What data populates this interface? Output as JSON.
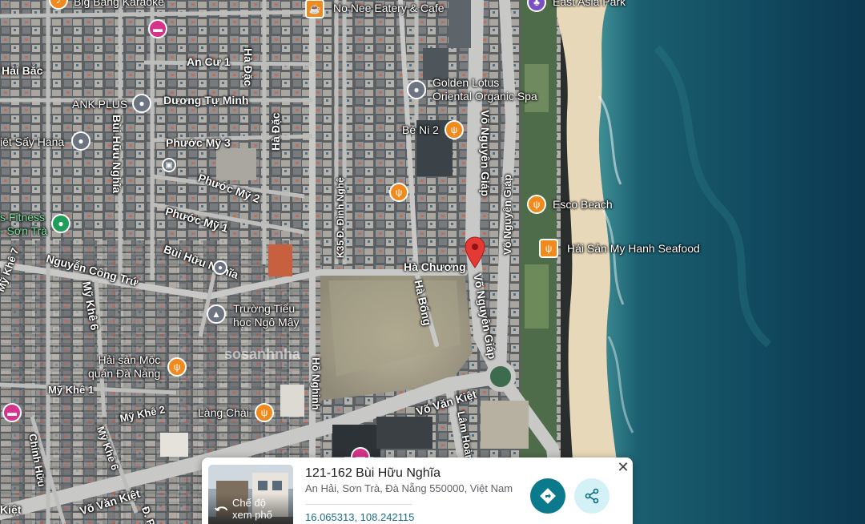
{
  "map": {
    "streets": [
      {
        "id": "hai-bac",
        "text": "Hải Bắc"
      },
      {
        "id": "an-cu-1",
        "text": "An Cư 1"
      },
      {
        "id": "duong-tu-minh",
        "text": "Dương Tự Minh"
      },
      {
        "id": "ha-dac-top",
        "text": "Hà Đặc"
      },
      {
        "id": "ha-dac-mid",
        "text": "Hà Đặc"
      },
      {
        "id": "phuoc-my-3",
        "text": "Phước Mỹ 3"
      },
      {
        "id": "phuoc-my-2",
        "text": "Phước Mỹ 2"
      },
      {
        "id": "phuoc-my-1",
        "text": "Phước Mỹ 1"
      },
      {
        "id": "bui-huu-nghia-v",
        "text": "Bùi Hữu Nghĩa"
      },
      {
        "id": "bui-huu-nghia-d",
        "text": "Bùi Hữu Nghĩa"
      },
      {
        "id": "nguyen-cong-tru",
        "text": "Nguyễn Công Trứ"
      },
      {
        "id": "my-khe-7",
        "text": "Mỹ Khê 7"
      },
      {
        "id": "my-khe-6a",
        "text": "Mỹ Khê 6"
      },
      {
        "id": "my-khe-1",
        "text": "Mỹ Khê 1"
      },
      {
        "id": "my-khe-2",
        "text": "Mỹ Khê 2"
      },
      {
        "id": "my-khe-6b",
        "text": "Mỹ Khê 6"
      },
      {
        "id": "chinh-huu",
        "text": "Chính Hữu"
      },
      {
        "id": "k35-dinh-nghe",
        "text": "K35 Đ. Đình Nghệ"
      },
      {
        "id": "ha-chuong",
        "text": "Hà Chương"
      },
      {
        "id": "ha-bong",
        "text": "Hà Bổng"
      },
      {
        "id": "ho-nghinh",
        "text": "Hồ Nghinh"
      },
      {
        "id": "vo-nguyen-giap-1",
        "text": "Võ Nguyên Giáp"
      },
      {
        "id": "vo-nguyen-giap-2",
        "text": "Võ Nguyên Giáp"
      },
      {
        "id": "vo-nguyen-giap-3",
        "text": "Võ Nguyên Giáp"
      },
      {
        "id": "vo-van-kiet-1",
        "text": "Võ Văn Kiệt"
      },
      {
        "id": "vo-van-kiet-2",
        "text": "Võ Văn Kiệt"
      },
      {
        "id": "lam-hoanh",
        "text": "Lâm Hoành"
      },
      {
        "id": "kiet",
        "text": "Kiệt"
      },
      {
        "id": "d-p",
        "text": "Đ. P"
      }
    ],
    "pois": [
      {
        "id": "big-bang-karaoke",
        "text": "Big Bang Karaoke",
        "icon": "karaoke-icon"
      },
      {
        "id": "no-nee",
        "text": "No Nee Eatery & Cafe",
        "icon": "cafe-icon"
      },
      {
        "id": "east-asia-park",
        "text": "East Asia Park",
        "icon": "park-icon"
      },
      {
        "id": "ank-plus",
        "text": "ANK PLUS",
        "icon": "shop-icon"
      },
      {
        "id": "golden-lotus",
        "text": "Golden Lotus\nOriental Organic Spa",
        "icon": "spa-icon"
      },
      {
        "id": "be-ni-2",
        "text": "Bé Ni 2",
        "icon": "restaurant-icon"
      },
      {
        "id": "viet-say-hana",
        "text": "iệt Sấy Hana",
        "icon": "shop-icon"
      },
      {
        "id": "fitness",
        "text": "s Fitness\n- Sơn Trà",
        "icon": "gym-icon"
      },
      {
        "id": "esco-beach",
        "text": "Esco Beach",
        "icon": "restaurant-icon"
      },
      {
        "id": "hai-san-my-hanh",
        "text": "Hải Sản My Hanh Seafood",
        "icon": "restaurant-icon"
      },
      {
        "id": "truong-tieu-hoc",
        "text": "Trường Tiểu\nhọc Ngô Mây",
        "icon": "school-icon"
      },
      {
        "id": "hai-san-moc",
        "text": "Hải sản Mộc\nquán Đà Nẵng",
        "icon": "restaurant-icon"
      },
      {
        "id": "lang-chai",
        "text": "Làng Chài",
        "icon": "restaurant-icon"
      }
    ],
    "watermark": "sosanhnha"
  },
  "place_card": {
    "title": "121-162 Bùi Hữu Nghĩa",
    "address": "An Hải, Sơn Trà, Đà Nẵng 550000, Việt Nam",
    "coordinates": "16.065313, 108.242115",
    "street_view_label": "Chế độ\nxem phố",
    "directions_icon": "directions-icon",
    "share_icon": "share-icon",
    "close_icon": "close-icon"
  },
  "colors": {
    "sea_deep": "#0d3d52",
    "sea_shallow": "#1f6e7a",
    "beach": "#e9ddc0",
    "road": "#c9c9c9",
    "orange_pin": "#f08a1c",
    "pink_pin": "#d6338a",
    "red_marker": "#e53935",
    "directions_button": "#0b7a8c"
  }
}
